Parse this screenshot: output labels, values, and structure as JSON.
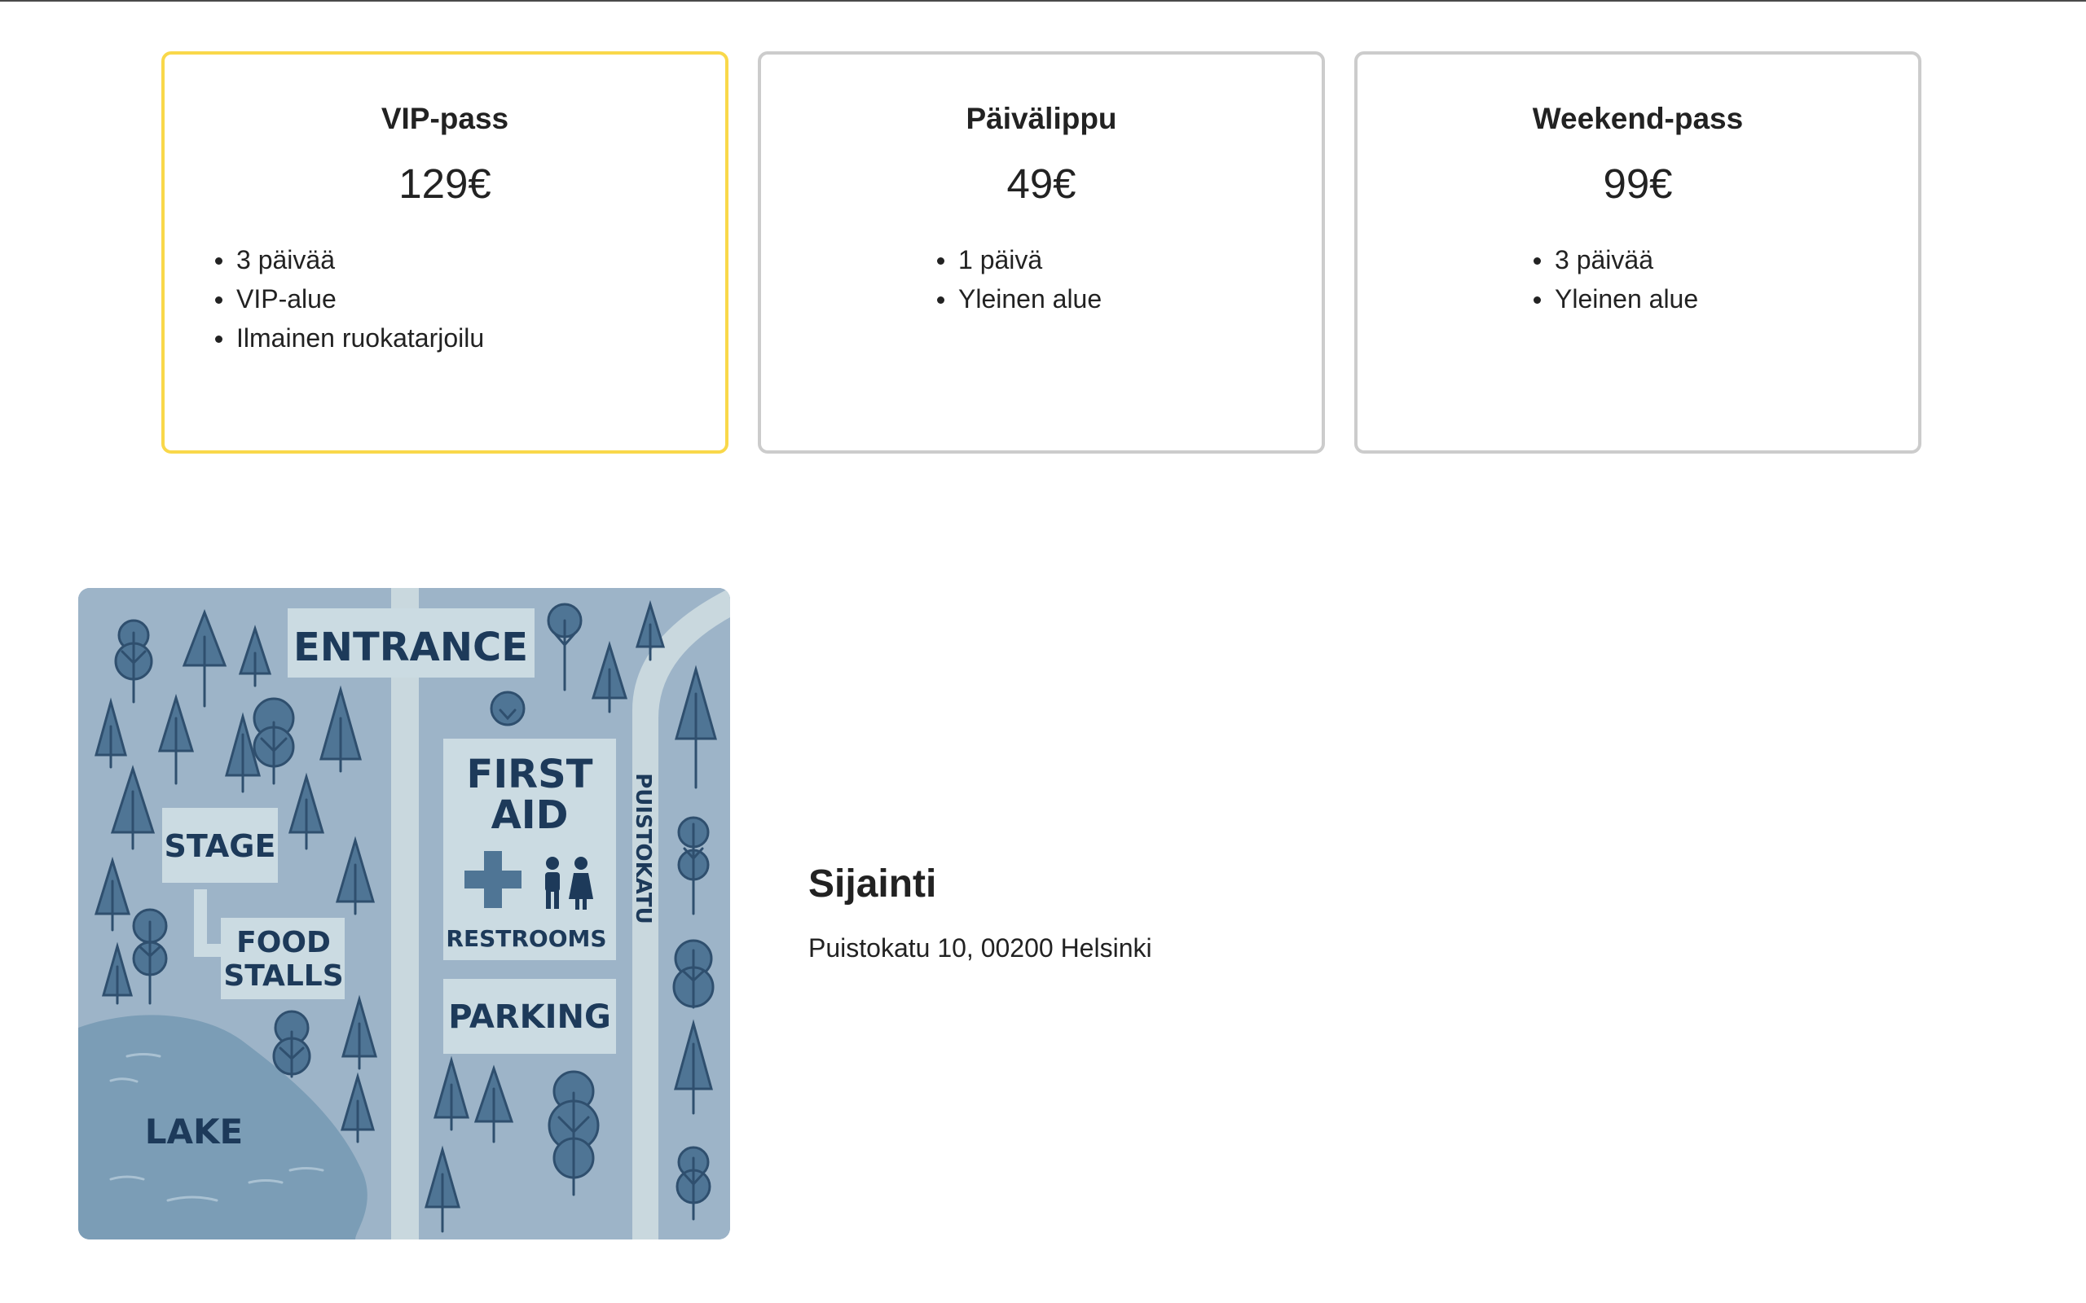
{
  "tickets": [
    {
      "title": "VIP-pass",
      "price": "129€",
      "features": [
        "3 päivää",
        "VIP-alue",
        "Ilmainen ruokatarjoilu"
      ],
      "highlight_color": "#f9d84a"
    },
    {
      "title": "Päivälippu",
      "price": "49€",
      "features": [
        "1 päivä",
        "Yleinen alue"
      ]
    },
    {
      "title": "Weekend-pass",
      "price": "99€",
      "features": [
        "3 päivää",
        "Yleinen alue"
      ]
    }
  ],
  "map": {
    "labels": {
      "entrance": "ENTRANCE",
      "first_aid_line1": "FIRST",
      "first_aid_line2": "AID",
      "restrooms": "RESTROOMS",
      "stage": "STAGE",
      "food_stalls_line1": "FOOD",
      "food_stalls_line2": "STALLS",
      "parking": "PARKING",
      "lake": "LAKE",
      "street": "PUISTOKATU"
    },
    "colors": {
      "ground": "#9db4c8",
      "path": "#c9d8de",
      "lake": "#7b9db6",
      "tree": "#4f7595",
      "label_text": "#1d3a5a",
      "label_bg": "#cbdbe2"
    }
  },
  "location": {
    "heading": "Sijainti",
    "address": "Puistokatu 10, 00200 Helsinki"
  }
}
